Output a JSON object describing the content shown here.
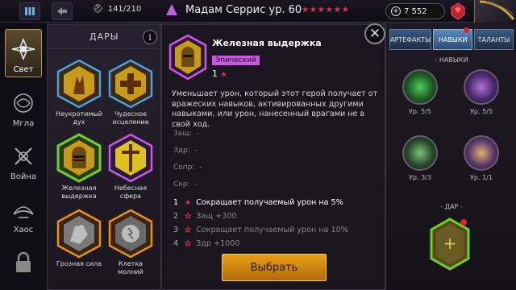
{
  "topbar": {
    "count": "141/210",
    "title": "Мадам Серрис ур. 60",
    "stars": "★★★★★★",
    "currency": "7 552"
  },
  "affinities": [
    {
      "label": "Свет",
      "active": true
    },
    {
      "label": "Мгла",
      "active": false
    },
    {
      "label": "Война",
      "active": false
    },
    {
      "label": "Хаос",
      "active": false
    }
  ],
  "gifts": {
    "title": "ДАРЫ",
    "info": "i",
    "items": [
      {
        "label": "Неукротимый дух"
      },
      {
        "label": "Чудесное исцеление"
      },
      {
        "label": "Железная выдержка"
      },
      {
        "label": "Небесная сфера"
      },
      {
        "label": "Грозная сила"
      },
      {
        "label": "Клетка молний"
      }
    ]
  },
  "detail": {
    "name": "Железная выдержка",
    "rarity": "Эпический",
    "level": "1",
    "star": "★",
    "description": "Уменьшает урон, который этот герой получает от вражеских навыков, активированных другими навыками, или урон, нанесенный врагами не в свой ход.",
    "stats": [
      {
        "label": "Защ:",
        "value": "-"
      },
      {
        "label": "Здр:",
        "value": "-"
      },
      {
        "label": "Сопр:",
        "value": "-"
      },
      {
        "label": "Скр:",
        "value": "-"
      }
    ],
    "levels": [
      {
        "n": "1",
        "text": "Сокращает получаемый урон на 5%",
        "active": true
      },
      {
        "n": "2",
        "text": "Защ +300",
        "active": false
      },
      {
        "n": "3",
        "text": "Сокращает получаемый урон на 10%",
        "active": false
      },
      {
        "n": "4",
        "text": "Здр +1000",
        "active": false
      }
    ],
    "choose_label": "Выбрать",
    "close": "✕"
  },
  "right": {
    "tabs": [
      {
        "label": "АРТЕФАКТЫ",
        "active": false
      },
      {
        "label": "НАВЫКИ",
        "active": true
      },
      {
        "label": "ТАЛАНТЫ",
        "active": false
      }
    ],
    "skills_title": "НАВЫКИ",
    "skills": [
      {
        "level": "Ур. 5/5"
      },
      {
        "level": "Ур. 5/5"
      },
      {
        "level": "Ур. 3/3"
      },
      {
        "level": "Ур. 1/1"
      }
    ],
    "gift_title": "ДАР",
    "gift_plus": "+"
  },
  "colors": {
    "accent": "#e7a018",
    "epic": "#d054e8",
    "star": "#e0304a",
    "active_gift": "#6fd02a"
  }
}
